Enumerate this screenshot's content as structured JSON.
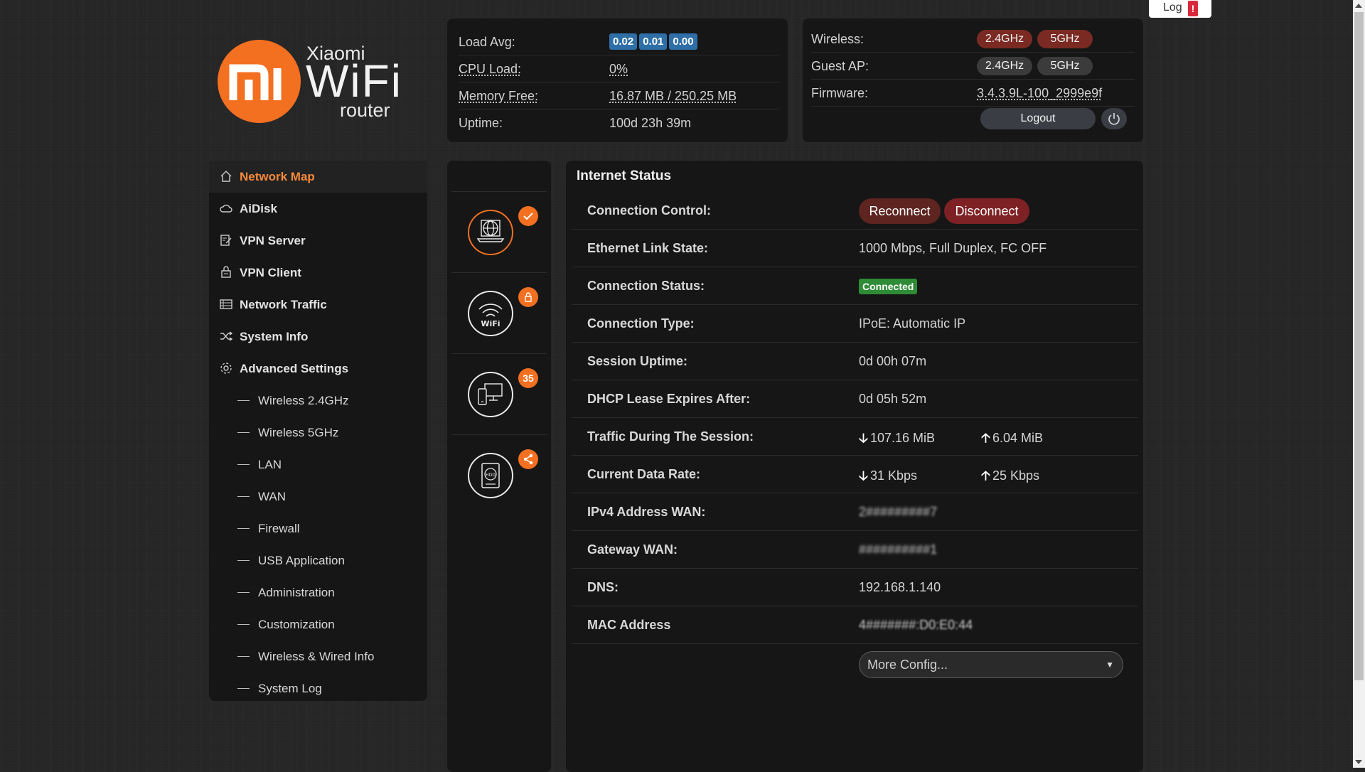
{
  "logo": {
    "brand": "Xiaomi",
    "wifi": "WiFi",
    "router": "router",
    "mi": "mi"
  },
  "colors": {
    "accent": "#f37021",
    "connected": "#2e8b36",
    "chip": "#2f6fa7",
    "danger": "#7e2124"
  },
  "system_panel": {
    "load_avg_label": "Load Avg:",
    "load_avg": [
      "0.02",
      "0.01",
      "0.00"
    ],
    "cpu_load_label": "CPU Load:",
    "cpu_load": "0%",
    "memory_free_label": "Memory Free:",
    "memory_free": "16.87 MB / 250.25 MB",
    "uptime_label": "Uptime:",
    "uptime": "100d 23h 39m"
  },
  "wireless_panel": {
    "wireless_label": "Wireless:",
    "guest_ap_label": "Guest AP:",
    "band_24": "2.4GHz",
    "band_5": "5GHz",
    "firmware_label": "Firmware:",
    "firmware": "3.4.3.9L-100_2999e9f",
    "logout_label": "Logout",
    "power_icon": "power-icon"
  },
  "log_button": {
    "label": "Log",
    "alert": "!"
  },
  "sidebar": {
    "items": [
      {
        "label": "Network Map",
        "icon": "home-icon",
        "active": true
      },
      {
        "label": "AiDisk",
        "icon": "cloud-icon"
      },
      {
        "label": "VPN Server",
        "icon": "vpn-server-icon"
      },
      {
        "label": "VPN Client",
        "icon": "vpn-client-icon"
      },
      {
        "label": "Network Traffic",
        "icon": "traffic-list-icon"
      },
      {
        "label": "System Info",
        "icon": "shuffle-icon"
      },
      {
        "label": "Advanced Settings",
        "icon": "gear-icon"
      }
    ],
    "subitems": [
      "Wireless 2.4GHz",
      "Wireless 5GHz",
      "LAN",
      "WAN",
      "Firewall",
      "USB Application",
      "Administration",
      "Customization",
      "Wireless & Wired Info",
      "System Log"
    ]
  },
  "devices": [
    {
      "name": "internet",
      "icon": "globe-laptop-icon",
      "badge_icon": "check-icon"
    },
    {
      "name": "wifi",
      "icon": "wifi-icon",
      "badge_icon": "lock-icon",
      "label": "WiFi"
    },
    {
      "name": "clients",
      "icon": "devices-icon",
      "badge": "35"
    },
    {
      "name": "usb-disk",
      "icon": "hdd-icon",
      "badge_icon": "share-icon",
      "label": "HDD"
    }
  ],
  "status": {
    "title": "Internet Status",
    "connection_control_label": "Connection Control:",
    "reconnect": "Reconnect",
    "disconnect": "Disconnect",
    "ethernet_label": "Ethernet Link State:",
    "ethernet_value": "1000 Mbps, Full Duplex, FC OFF",
    "connection_status_label": "Connection Status:",
    "connection_status_value": "Connected",
    "connection_type_label": "Connection Type:",
    "connection_type_value": "IPoE: Automatic IP",
    "session_uptime_label": "Session Uptime:",
    "session_uptime_value": "0d 00h 07m",
    "dhcp_label": "DHCP Lease Expires After:",
    "dhcp_value": "0d 05h 52m",
    "traffic_label": "Traffic During The Session:",
    "traffic_down": "107.16 MiB",
    "traffic_up": "6.04 MiB",
    "rate_label": "Current Data Rate:",
    "rate_down": "31 Kbps",
    "rate_up": "25 Kbps",
    "ipv4_label": "IPv4 Address WAN:",
    "ipv4_value": "2#########7",
    "gateway_label": "Gateway WAN:",
    "gateway_value": "##########1",
    "dns_label": "DNS:",
    "dns_value": "192.168.1.140",
    "mac_label": "MAC Address",
    "mac_value": "4#######:D0:E0:44",
    "more_config": "More Config..."
  }
}
